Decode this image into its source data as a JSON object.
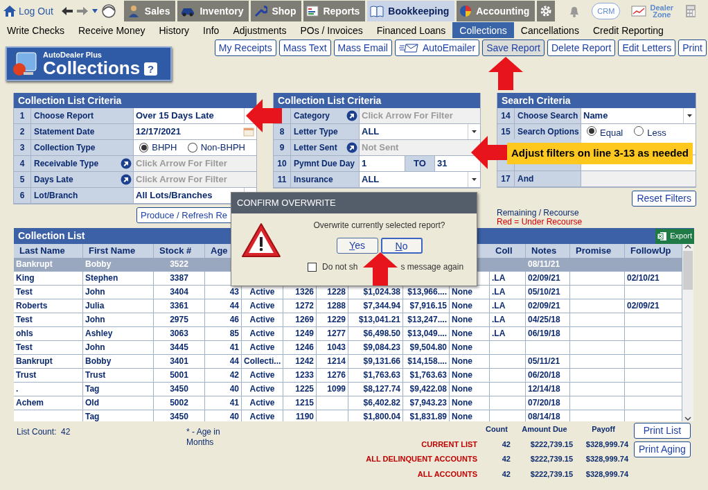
{
  "top_bar": {
    "logout": "Log Out",
    "tabs": [
      {
        "label": "Sales",
        "selected": false
      },
      {
        "label": "Inventory",
        "selected": false
      },
      {
        "label": "Shop",
        "selected": false
      },
      {
        "label": "Reports",
        "selected": false
      },
      {
        "label": "Bookkeeping",
        "selected": true
      },
      {
        "label": "Accounting",
        "selected": false
      }
    ],
    "crm": "CRM",
    "dealer_zone": "Dealer Zone"
  },
  "sub_nav": [
    {
      "label": "Write Checks",
      "selected": false
    },
    {
      "label": "Receive Money",
      "selected": false
    },
    {
      "label": "History",
      "selected": false
    },
    {
      "label": "Info",
      "selected": false
    },
    {
      "label": "Adjustments",
      "selected": false
    },
    {
      "label": "POs / Invoices",
      "selected": false
    },
    {
      "label": "Financed Loans",
      "selected": false
    },
    {
      "label": "Collections",
      "selected": true
    },
    {
      "label": "Cancellations",
      "selected": false
    },
    {
      "label": "Credit Reporting",
      "selected": false
    }
  ],
  "logo": {
    "brand": "AutoDealer Plus",
    "title": "Collections",
    "help": "?"
  },
  "toolbar": [
    {
      "label": "My Receipts",
      "kind": "plain",
      "highlighted": false
    },
    {
      "label": "Mass Text",
      "kind": "plain",
      "highlighted": false
    },
    {
      "label": "Mass Email",
      "kind": "plain",
      "highlighted": false
    },
    {
      "label": "AutoEmailer",
      "kind": "mail",
      "highlighted": false
    },
    {
      "label": "Save Report",
      "kind": "plain",
      "highlighted": true
    },
    {
      "label": "Delete Report",
      "kind": "plain",
      "highlighted": false
    },
    {
      "label": "Edit Letters",
      "kind": "plain",
      "highlighted": false
    },
    {
      "label": "Print",
      "kind": "plain",
      "highlighted": false
    }
  ],
  "criteria_panels": [
    {
      "title": "Collection List Criteria",
      "rows": [
        {
          "number": "1",
          "label": "Choose Report",
          "kind": "select",
          "value": "Over 15 Days Late"
        },
        {
          "number": "2",
          "label": "Statement Date",
          "kind": "date",
          "value": "12/17/2021"
        },
        {
          "number": "3",
          "label": "Collection Type",
          "kind": "radio",
          "options": [
            {
              "label": "BHPH",
              "selected": true
            },
            {
              "label": "Non-BHPH",
              "selected": false
            }
          ]
        },
        {
          "number": "4",
          "label": "Receivable Type",
          "kind": "filter",
          "placeholder": "Click Arrow For Filter"
        },
        {
          "number": "5",
          "label": "Days Late",
          "kind": "filter",
          "placeholder": "Click Arrow For Filter"
        },
        {
          "number": "6",
          "label": "Lot/Branch",
          "kind": "select",
          "value": "All Lots/Branches"
        }
      ]
    },
    {
      "title": "Collection List Criteria",
      "rows": [
        {
          "label": "Category",
          "kind": "filter",
          "placeholder": "Click Arrow For Filter"
        },
        {
          "number": "8",
          "label": "Letter Type",
          "kind": "select",
          "value": "ALL"
        },
        {
          "number": "9",
          "label": "Letter Sent",
          "kind": "filter",
          "placeholder": "Not Sent"
        },
        {
          "number": "10",
          "label": "Pymnt Due Day",
          "kind": "range",
          "from": "1",
          "to_label": "TO",
          "to": "31"
        },
        {
          "number": "11",
          "label": "Insurance",
          "kind": "select",
          "value": "ALL"
        }
      ]
    },
    {
      "title": "Search Criteria",
      "rows": [
        {
          "number": "14",
          "label": "Choose Search",
          "kind": "select",
          "value": "Name"
        },
        {
          "number": "15",
          "label": "Search Options",
          "kind": "radio",
          "options": [
            {
              "label": "Equal",
              "selected": true
            },
            {
              "label": "Less",
              "selected": false
            }
          ]
        },
        {
          "kind": "text"
        },
        {
          "number": "17",
          "label": "And",
          "kind": "blank"
        }
      ]
    }
  ],
  "produce_button": "Produce / Refresh Re",
  "reset_button": "Reset Filters",
  "legend": [
    {
      "text": "Remaining / Recourse",
      "kind": "note"
    },
    {
      "text": "Red = Under Recourse",
      "kind": "warning"
    }
  ],
  "callout": "Adjust filters on line 3-13 as needed",
  "collection_list": {
    "title": "Collection List",
    "export": "Export",
    "columns": [
      "Last Name",
      "First Name",
      "Stock #",
      "Age",
      null,
      null,
      null,
      null,
      null,
      null,
      "Coll",
      "Notes",
      "Promise",
      "FollowUp"
    ],
    "rows": [
      {
        "selected": true,
        "cells": [
          "Bankrupt",
          "Bobby",
          "3522",
          null,
          null,
          null,
          null,
          null,
          null,
          null,
          null,
          "08/11/21",
          null,
          null
        ]
      },
      {
        "selected": false,
        "cells": [
          "King",
          "Stephen",
          "3387",
          null,
          null,
          null,
          null,
          null,
          null,
          null,
          ".LA",
          "02/09/21",
          null,
          "02/10/21"
        ]
      },
      {
        "selected": false,
        "cells": [
          "Test",
          "John",
          "3404",
          "43",
          "Active",
          "1326",
          "1228",
          "$1,024.38",
          "$13,966....",
          "None",
          ".LA",
          "05/10/21",
          null,
          null
        ]
      },
      {
        "selected": false,
        "cells": [
          "Roberts",
          "Julia",
          "3361",
          "44",
          "Active",
          "1272",
          "1288",
          "$7,344.94",
          "$7,916.15",
          "None",
          ".LA",
          "02/09/21",
          null,
          "02/09/21"
        ]
      },
      {
        "selected": false,
        "cells": [
          "Test",
          "John",
          "2975",
          "46",
          "Active",
          "1269",
          "1229",
          "$13,041.21",
          "$13,247....",
          "None",
          ".LA",
          "04/25/18",
          null,
          null
        ]
      },
      {
        "selected": false,
        "cells": [
          "ohls",
          "Ashley",
          "3063",
          "85",
          "Active",
          "1249",
          "1277",
          "$6,498.50",
          "$13,049....",
          "None",
          ".LA",
          "06/19/18",
          null,
          null
        ]
      },
      {
        "selected": false,
        "cells": [
          "Test",
          "John",
          "3445",
          "41",
          "Active",
          "1246",
          "1043",
          "$9,084.23",
          "$9,504.80",
          "None",
          null,
          null,
          null,
          null
        ]
      },
      {
        "selected": false,
        "cells": [
          "Bankrupt",
          "Bobby",
          "3401",
          "44",
          "Collecti...",
          "1242",
          "1214",
          "$9,131.66",
          "$14,158....",
          "None",
          null,
          "05/11/21",
          null,
          null
        ]
      },
      {
        "selected": false,
        "cells": [
          "Trust",
          "Trust",
          "5001",
          "42",
          "Active",
          "1233",
          "1276",
          "$1,763.63",
          "$1,763.63",
          "None",
          null,
          "06/20/18",
          null,
          null
        ]
      },
      {
        "selected": false,
        "cells": [
          ".",
          "Tag",
          "3450",
          "40",
          "Active",
          "1225",
          "1099",
          "$8,127.74",
          "$9,422.08",
          "None",
          null,
          "12/14/18",
          null,
          null
        ]
      },
      {
        "selected": false,
        "cells": [
          "Achem",
          "Old",
          "5002",
          "41",
          "Active",
          "1215",
          null,
          "$6,402.82",
          "$7,943.23",
          "None",
          null,
          "07/20/18",
          null,
          null
        ]
      },
      {
        "selected": false,
        "cells": [
          null,
          "Tag",
          "3450",
          "40",
          "Active",
          "1190",
          null,
          "$1,800.04",
          "$1,831.89",
          "None",
          null,
          "08/14/18",
          null,
          null
        ]
      }
    ]
  },
  "footer": {
    "list_count_label": "List Count:",
    "list_count": "42",
    "age_note": "* - Age in Months",
    "totals": {
      "columns": [
        "Count",
        "Amount Due",
        "Payoff"
      ],
      "rows": [
        {
          "label": "CURRENT LIST",
          "count": "42",
          "amount_due": "$222,739.15",
          "payoff": "$328,999.74"
        },
        {
          "label": "ALL DELINQUENT ACCOUNTS",
          "count": "42",
          "amount_due": "$222,739.15",
          "payoff": "$328,999.74"
        },
        {
          "label": "ALL ACCOUNTS",
          "count": "42",
          "amount_due": "$222,739.15",
          "payoff": "$328,999.74"
        }
      ]
    },
    "buttons": [
      "Print List",
      "Print Aging"
    ]
  },
  "dialog": {
    "title": "CONFIRM OVERWRITE",
    "message": "Overwrite currently selected report?",
    "buttons": [
      {
        "label": "Yes",
        "focused": false
      },
      {
        "label": "No",
        "focused": true
      }
    ],
    "checkbox": {
      "label_parts": [
        "Do not sh",
        "s message again"
      ],
      "checked": false
    }
  }
}
